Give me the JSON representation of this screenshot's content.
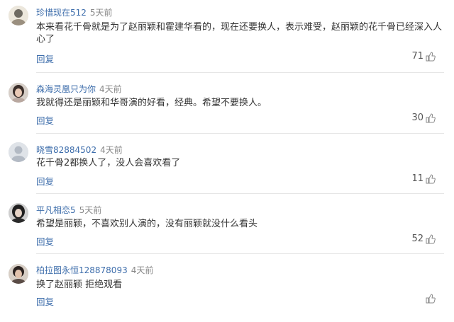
{
  "comments": [
    {
      "username": "珍惜现在512",
      "time": "5天前",
      "text": "本来看花千骨就是为了赵丽颖和霍建华看的，现在还要换人，表示难受，赵丽颖的花千骨已经深入人心了",
      "reply_label": "回复",
      "likes": "71"
    },
    {
      "username": "森海灵凰只为你",
      "time": "4天前",
      "text": "我就得还是丽颖和华哥演的好看，经典。希望不要换人。",
      "reply_label": "回复",
      "likes": "30"
    },
    {
      "username": "晓雪82884502",
      "time": "4天前",
      "text": "花千骨2都换人了，没人会喜欢看了",
      "reply_label": "回复",
      "likes": "11"
    },
    {
      "username": "平凡相恋5",
      "time": "5天前",
      "text": "希望是丽颖，不喜欢别人演的，没有丽颖就没什么看头",
      "reply_label": "回复",
      "likes": "52"
    },
    {
      "username": "柏拉图永恒128878093",
      "time": "4天前",
      "text": "换了赵丽颖 拒绝观看",
      "reply_label": "回复",
      "likes": ""
    }
  ],
  "icons": {
    "like": "thumbs-up-icon",
    "avatar": "avatar"
  },
  "colors": {
    "username": "#3d6dab",
    "time": "#888888",
    "reply": "#3d6dab",
    "text": "#333333",
    "divider": "#e6e6e6"
  }
}
